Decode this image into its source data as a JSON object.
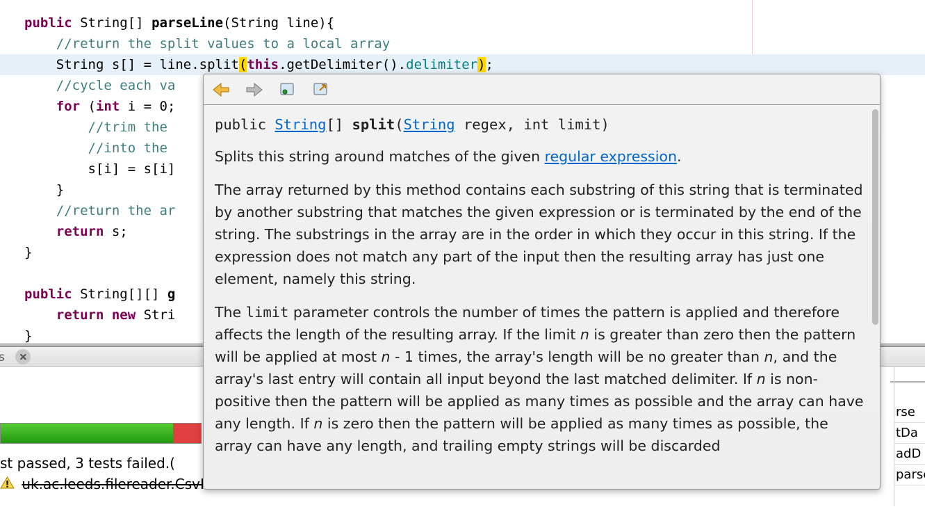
{
  "code": {
    "l1": {
      "kw": "public",
      "type": "String[]",
      "name": "parseLine",
      "params": "(String line){"
    },
    "l2": "//return the split values to a local array",
    "l3": {
      "pre": "String s[] = line.",
      "call": "split",
      "open": "(",
      "thiskw": "this",
      "mid": ".getDelimiter().",
      "field": "delimiter",
      "close": ")",
      "end": ";"
    },
    "l4": "//cycle each va",
    "l5": {
      "kw": "for",
      "rest": " (",
      "kw2": "int",
      "rest2": " i = 0;"
    },
    "l6": "//trim the ",
    "l7": "//into the ",
    "l8": "s[i] = s[i]",
    "l9": "}",
    "l10": "//return the ar",
    "l11": {
      "kw": "return",
      "rest": " s;"
    },
    "l12": "}",
    "l13": {
      "kw": "public",
      "rest": " String[][] ",
      "bold": "g"
    },
    "l14": {
      "kw": "return new",
      "rest": " Stri"
    },
    "l15": "}"
  },
  "popup": {
    "sig": {
      "pre": "public ",
      "ret_link": "String",
      "ret_post": "[] ",
      "name": "split",
      "open": "(",
      "param_link": "String",
      "rest": " regex, int limit)"
    },
    "p1": {
      "pre": "Splits this string around matches of the given ",
      "link": "regular expression",
      "post": "."
    },
    "p2": "The array returned by this method contains each substring of this string that is terminated by another substring that matches the given expression or is terminated by the end of the string. The substrings in the array are in the order in which they occur in this string. If the expression does not match any part of the input then the resulting array has just one element, namely this string.",
    "p3_a": "The ",
    "p3_limit": "limit",
    "p3_b": " parameter controls the number of times the pattern is applied and therefore affects the length of the resulting array. If the limit ",
    "p3_n1": "n",
    "p3_c": " is greater than zero then the pattern will be applied at most ",
    "p3_n2": "n",
    "p3_d": " - 1 times, the array's length will be no greater than ",
    "p3_n3": "n",
    "p3_e": ", and the array's last entry will contain all input beyond the last matched delimiter. If ",
    "p3_n4": "n",
    "p3_f": " is non-positive then the pattern will be applied as many times as possible and the array can have any length. If ",
    "p3_n5": "n",
    "p3_g": " is zero then the pattern will be applied as many times as possible, the array can have any length, and trailing empty strings will be discarded"
  },
  "tabs": {
    "closed_label": "s"
  },
  "results": {
    "summary": "st passed, 3 tests failed.(",
    "item": "uk.ac.leeds.filereader.CsvReaderTest",
    "item_status": "Failed"
  },
  "right": {
    "r1": "rse",
    "r2": "tDa",
    "r3": "adD",
    "r4": "parse"
  }
}
